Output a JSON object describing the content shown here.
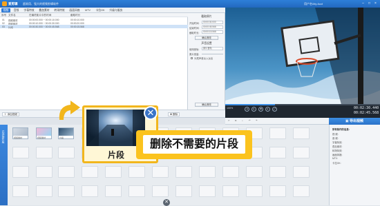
{
  "app": {
    "title": "爱剪辑",
    "subtitle": "超易用、强大的视频剪辑软件",
    "user": "用户名/My Acct"
  },
  "tabs": [
    "视频",
    "音频",
    "字幕特效",
    "叠加素材",
    "转场特效",
    "画面风格",
    "MTV",
    "卡拉OK",
    "升级与服务"
  ],
  "clip_list": {
    "headers": [
      "序号",
      "文件名",
      "在最终影片中的时间",
      "截取时长"
    ],
    "rows": [
      {
        "n": "01",
        "name": "视频素材",
        "time": "00:00:00.000 ~ 00:00:10.000",
        "dur": "00:00:10.000"
      },
      {
        "n": "02",
        "name": "视频素材",
        "time": "00:00:10.000 ~ 00:00:30.000",
        "dur": "00:00:20.000"
      },
      {
        "n": "03",
        "name": "片段",
        "time": "00:00:30.000 ~ 00:00:45.568",
        "dur": "00:00:15.568"
      }
    ]
  },
  "props": {
    "section1": "截取原片",
    "start_label": "开始时间:",
    "start_val": "00:00:30.000",
    "end_label": "结束时间:",
    "end_val": "00:00:45.568",
    "dur_label": "截取时长:",
    "dur_val": "00:00:15.568",
    "modify_btn": "确认修改",
    "section2": "声音设置",
    "track_label": "使用音轨:",
    "track_val": "原片音轨",
    "vol_label": "原片音量:",
    "check_label": "头尾声音淡入淡出",
    "confirm_btn": "确认修改"
  },
  "toolbar": {
    "add_video": "添加视频",
    "delete": "删除"
  },
  "player": {
    "current": "00:02:30.440",
    "total": "00:02:45.568",
    "speed": "100%"
  },
  "export_btn": "导出视频",
  "right_panel": {
    "title": "所有制作的信息:",
    "lines": [
      "视    频:",
      "音    频:",
      "字幕特效:",
      "叠加素材:",
      "转场特效:",
      "画面风格:",
      "MTV:",
      "卡拉OK:"
    ]
  },
  "timeline": {
    "side_label": "已添加片段",
    "clips": [
      {
        "label": "视频素材"
      },
      {
        "label": "视频素材"
      },
      {
        "label": "片段"
      }
    ]
  },
  "callout": {
    "clip_label": "片段",
    "banner": "删除不需要的片段"
  }
}
